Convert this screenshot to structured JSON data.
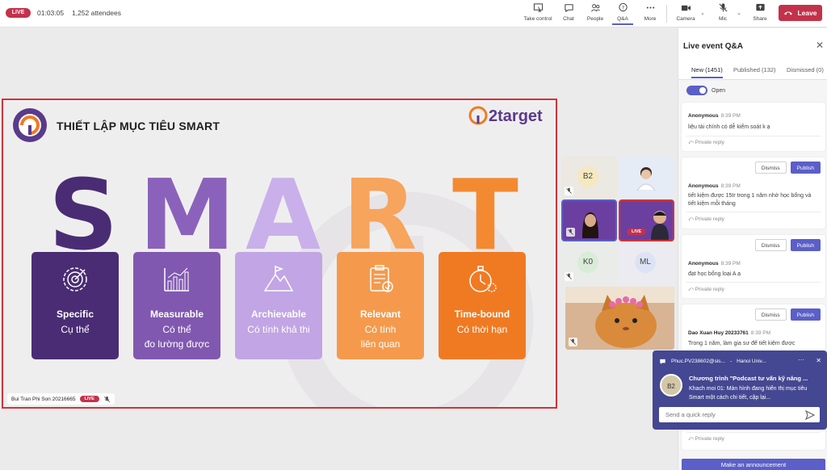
{
  "topbar": {
    "live_label": "LIVE",
    "timer": "01:03:05",
    "attendees": "1,252 attendees",
    "buttons": [
      {
        "label": "Take control",
        "icon": "take-control-icon"
      },
      {
        "label": "Chat",
        "icon": "chat-icon"
      },
      {
        "label": "People",
        "icon": "people-icon"
      },
      {
        "label": "Q&A",
        "icon": "qa-icon"
      },
      {
        "label": "More",
        "icon": "more-icon"
      },
      {
        "label": "Camera",
        "icon": "camera-icon"
      },
      {
        "label": "Mic",
        "icon": "mic-off-icon"
      },
      {
        "label": "Share",
        "icon": "share-icon"
      }
    ],
    "leave_label": "Leave"
  },
  "slide": {
    "title": "THIẾT LẬP MỤC TIÊU SMART",
    "brand": "2target",
    "letters": [
      "S",
      "M",
      "A",
      "R",
      "T"
    ],
    "cards": [
      {
        "title": "Specific",
        "subtitle": "Cụ thể",
        "color": "#4a2c74",
        "letter_color": "#4a2c74",
        "icon": "target-gear-icon"
      },
      {
        "title": "Measurable",
        "subtitle": "Có thể\nđo lường được",
        "color": "#8158b0",
        "letter_color": "#8b62bb",
        "icon": "bar-chart-icon"
      },
      {
        "title": "Archievable",
        "subtitle": "Có tính khả thi",
        "color": "#c1a5e4",
        "letter_color": "#c9b0ea",
        "icon": "mountain-flag-icon"
      },
      {
        "title": "Relevant",
        "subtitle": "Có tính\nliên quan",
        "color": "#f59a4c",
        "letter_color": "#f7a45c",
        "icon": "clipboard-check-icon"
      },
      {
        "title": "Time-bound",
        "subtitle": "Có thời hạn",
        "color": "#f07a22",
        "letter_color": "#f38a32",
        "icon": "stopwatch-icon"
      }
    ],
    "presenter": "Bui Tran Phi Son 20216665",
    "presenter_live": "LIVE"
  },
  "participants": [
    {
      "initials": "B2",
      "bg": "#ece8e2",
      "avatar_bg": "#f6e8bf"
    },
    {
      "initials": "",
      "bg": "#e6ecf6",
      "avatar_bg": "#ffffff"
    },
    {
      "initials": "",
      "bg": "#6b3fa0",
      "avatar_bg": ""
    },
    {
      "initials": "",
      "bg": "#6b3fa0",
      "avatar_bg": "",
      "live": "LIVE"
    },
    {
      "initials": "K0",
      "bg": "#e9ece8",
      "avatar_bg": "#d8ecd8"
    },
    {
      "initials": "ML",
      "bg": "#ecebf1",
      "avatar_bg": "#dde3f4"
    },
    {
      "initials": "",
      "bg": "#c89a6e",
      "avatar_bg": ""
    }
  ],
  "qa": {
    "title": "Live event Q&A",
    "tabs": [
      "New (1451)",
      "Published (132)",
      "Dismissed (0)"
    ],
    "toggle_label": "Open",
    "dismiss_label": "Dismiss",
    "publish_label": "Publish",
    "private_reply": "Private reply",
    "questions": [
      {
        "author": "Anonymous",
        "time": "8:39 PM",
        "text": "liệu tài chính có dễ kiểm soát k ạ"
      },
      {
        "author": "Anonymous",
        "time": "8:39 PM",
        "text": "tiết kiệm được 15tr trong 1 năm nhờ học bổng và tiết kiệm mỗi tháng"
      },
      {
        "author": "Anonymous",
        "time": "8:39 PM",
        "text": "đạt học bổng loại A ạ"
      },
      {
        "author": "Dao Xuan Huy 20233761",
        "time": "8:39 PM",
        "text": "Trong 1 năm, làm gia sư để tiết kiệm được"
      }
    ],
    "announce_label": "Make an announcement"
  },
  "toast": {
    "sender": "Phuc.PV238602@sis...",
    "location": "Hanoi Univ...",
    "avatar": "B2",
    "title": "Chương trình \"Podcast tư vấn kỹ năng ...",
    "message": "Khach moi 01: Màn hình đang hiển thị mục tiêu Smart một cách chi tiết, cập lại...",
    "reply_placeholder": "Send a quick reply"
  },
  "colors": {
    "accent": "#5b5fc7",
    "live": "#c4314b",
    "toast": "#444791"
  }
}
